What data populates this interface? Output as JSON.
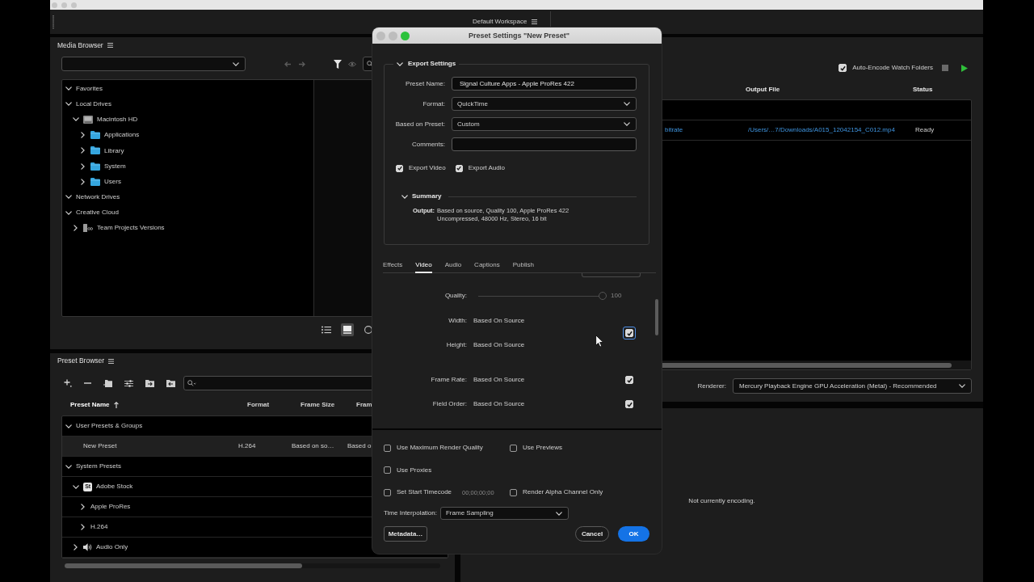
{
  "toolbar": {
    "workspace": "Default Workspace"
  },
  "media_browser": {
    "title": "Media Browser",
    "tree": [
      {
        "label": "Favorites",
        "expanded": true
      },
      {
        "label": "Local Drives",
        "expanded": true,
        "children": [
          {
            "label": "Macintosh HD",
            "kind": "drive",
            "expanded": true,
            "children": [
              {
                "label": "Applications",
                "kind": "folder",
                "expanded": false
              },
              {
                "label": "Library",
                "kind": "folder",
                "expanded": false
              },
              {
                "label": "System",
                "kind": "folder",
                "expanded": false
              },
              {
                "label": "Users",
                "kind": "folder",
                "expanded": false
              }
            ]
          }
        ]
      },
      {
        "label": "Network Drives",
        "expanded": true
      },
      {
        "label": "Creative Cloud",
        "expanded": true,
        "children": [
          {
            "label": "Team Projects Versions",
            "kind": "team_project",
            "expanded": false
          }
        ]
      }
    ],
    "view_buttons": [
      {
        "kind": "list",
        "selected": false
      },
      {
        "kind": "thumbnail",
        "selected": true
      },
      {
        "kind": "round",
        "selected": false
      }
    ]
  },
  "preset_browser": {
    "title": "Preset Browser",
    "columns": [
      {
        "label": "Preset Name",
        "sorted": true
      },
      {
        "label": "Format",
        "sorted": false
      },
      {
        "label": "Frame Size",
        "sorted": false
      },
      {
        "label": "Fram",
        "sorted": false
      }
    ],
    "tree": [
      {
        "label": "User Presets & Groups",
        "expanded": true,
        "selected": false,
        "children": [
          {
            "label": "New Preset",
            "selected": true,
            "format": "H.264",
            "frame_size": "Based on so…",
            "column_4": "Based o"
          }
        ]
      },
      {
        "label": "System Presets",
        "expanded": true,
        "selected": false,
        "children": [
          {
            "label": "Adobe Stock",
            "kind": "stock",
            "badge": "St",
            "expanded": true,
            "selected": false,
            "children": [
              {
                "label": "Apple ProRes",
                "expanded": false,
                "selected": false
              },
              {
                "label": "H.264",
                "expanded": false,
                "selected": false
              }
            ]
          },
          {
            "label": "Audio Only",
            "kind": "audio",
            "expanded": false,
            "selected": false
          }
        ]
      }
    ]
  },
  "queue": {
    "auto_encode": {
      "label": "Auto-Encode Watch Folders",
      "checked": true
    },
    "columns": [
      "Output File",
      "Status"
    ],
    "rows": [
      {
        "kind": "source"
      },
      {
        "kind": "output",
        "column_1": "bitrate",
        "output_file": "/Users/…7/Downloads/A015_12042154_C012.mp4",
        "status": "Ready"
      }
    ],
    "renderer": {
      "label": "Renderer:",
      "value": "Mercury Playback Engine GPU Acceleration (Metal) - Recommended"
    }
  },
  "encoding": {
    "message": "Not currently encoding."
  },
  "dialog": {
    "title": "Preset Settings \"New Preset\"",
    "export_settings": {
      "title": "Export Settings",
      "expanded": true,
      "fields": [
        {
          "kind": "text",
          "label": "Preset Name:",
          "value": "Signal Culture Apps - Apple ProRes 422"
        },
        {
          "kind": "dropdown",
          "label": "Format:",
          "value": "QuickTime"
        },
        {
          "kind": "dropdown",
          "label": "Based on Preset:",
          "value": "Custom"
        },
        {
          "kind": "text",
          "label": "Comments:"
        }
      ],
      "exports": [
        {
          "label": "Export Video",
          "checked": true
        },
        {
          "label": "Export Audio",
          "checked": true
        }
      ],
      "summary": {
        "title": "Summary",
        "expanded": true,
        "label": "Output:",
        "lines": [
          "Based on source, Quality 100, Apple ProRes 422",
          "Uncompressed, 48000 Hz, Stereo, 16 bit"
        ]
      }
    },
    "tabs": [
      {
        "label": "Effects",
        "selected": false
      },
      {
        "label": "Video",
        "selected": true
      },
      {
        "label": "Audio",
        "selected": false
      },
      {
        "label": "Captions",
        "selected": false
      },
      {
        "label": "Publish",
        "selected": false
      }
    ],
    "video": {
      "quality": {
        "label": "Quality:",
        "level": 1,
        "reading": "100",
        "disabled": true
      },
      "dimensions": {
        "linked": true,
        "focused": true,
        "rows": [
          {
            "label": "Width:",
            "value": "Based On Source"
          },
          {
            "label": "Height:",
            "value": "Based On Source"
          }
        ]
      },
      "rows": [
        {
          "label": "Frame Rate:",
          "value": "Based On Source",
          "checked": true
        },
        {
          "label": "Field Order:",
          "value": "Based On Source",
          "checked": true
        }
      ]
    },
    "option_rows": [
      {
        "items": [
          {
            "label": "Use Maximum Render Quality",
            "checked": false
          },
          {
            "label": "Use Previews",
            "checked": false
          }
        ]
      },
      {
        "items": [
          {
            "label": "Use Proxies",
            "checked": false
          }
        ]
      },
      {
        "items": [
          {
            "label": "Set Start Timecode",
            "checked": false,
            "timecode": "00;00;00;00"
          },
          {
            "label": "Render Alpha Channel Only",
            "checked": false
          }
        ]
      }
    ],
    "time_interpolation": {
      "label": "Time Interpolation:",
      "value": "Frame Sampling"
    },
    "buttons": [
      {
        "kind": "utility",
        "label": "Metadata…"
      },
      {
        "kind": "secondary",
        "label": "Cancel"
      },
      {
        "kind": "primary",
        "label": "OK"
      }
    ]
  }
}
